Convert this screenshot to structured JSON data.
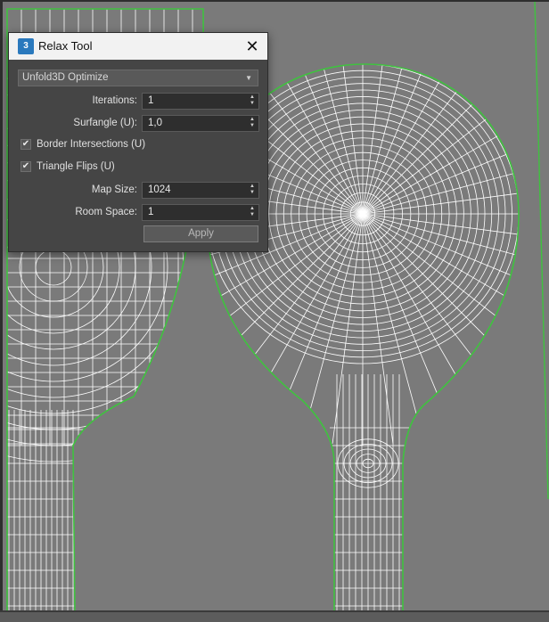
{
  "dialog": {
    "app_icon_text": "3",
    "title": "Relax Tool",
    "close_glyph": "✕",
    "method": "Unfold3D Optimize",
    "fields": [
      {
        "label": "Iterations:",
        "value": "1"
      },
      {
        "label": "Surfangle (U):",
        "value": "1,0"
      },
      {
        "label": "Map Size:",
        "value": "1024"
      },
      {
        "label": "Room Space:",
        "value": "1"
      }
    ],
    "checks": [
      {
        "label": "Border Intersections (U)",
        "checked": true
      },
      {
        "label": "Triangle Flips (U)",
        "checked": true
      }
    ],
    "apply_label": "Apply"
  },
  "viewport": {
    "background": "#7a7a7a",
    "wire_color": "#ffffff",
    "border_color": "#3fc23f"
  }
}
